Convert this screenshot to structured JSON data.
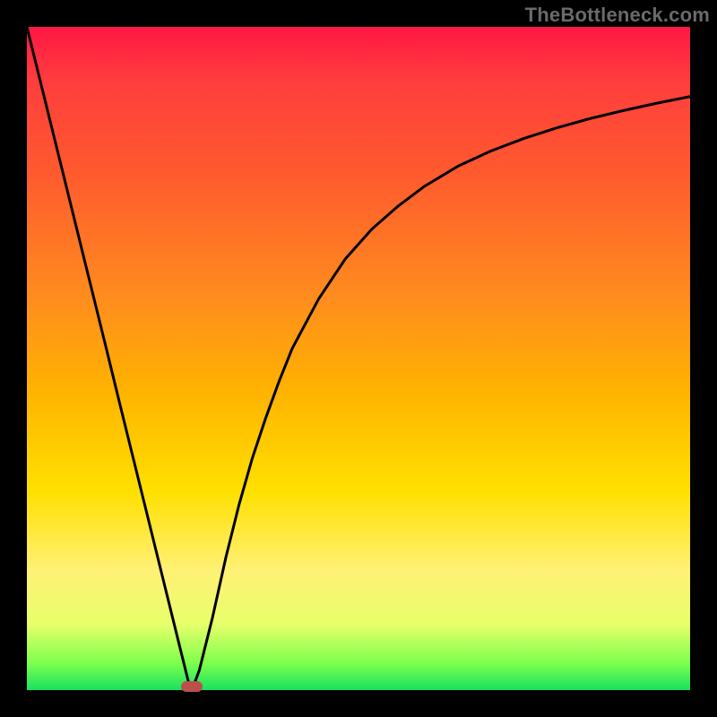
{
  "watermark": "TheBottleneck.com",
  "chart_data": {
    "type": "line",
    "title": "",
    "xlabel": "",
    "ylabel": "",
    "xlim": [
      0,
      100
    ],
    "ylim": [
      0,
      100
    ],
    "x": [
      0,
      2,
      4,
      6,
      8,
      10,
      12,
      14,
      16,
      18,
      20,
      22,
      24,
      24.5,
      25,
      26,
      28,
      30,
      32,
      34,
      36,
      38,
      40,
      44,
      48,
      52,
      56,
      60,
      65,
      70,
      75,
      80,
      85,
      90,
      95,
      100
    ],
    "y": [
      100,
      91.9,
      83.8,
      75.7,
      67.6,
      59.5,
      51.4,
      43.2,
      35.1,
      27,
      18.9,
      10.8,
      2.7,
      0.7,
      0.3,
      3,
      11,
      20,
      28,
      35,
      41,
      46.5,
      51.5,
      59,
      65,
      69.5,
      73,
      76,
      79,
      81.3,
      83.2,
      84.8,
      86.2,
      87.4,
      88.5,
      89.5
    ],
    "marker": {
      "x": 24.8,
      "y": 0.5
    },
    "background_gradient": {
      "stops": [
        {
          "pos": 0,
          "color": "#ff1744"
        },
        {
          "pos": 8,
          "color": "#ff3d3d"
        },
        {
          "pos": 22,
          "color": "#ff5a2e"
        },
        {
          "pos": 40,
          "color": "#ff8a1f"
        },
        {
          "pos": 55,
          "color": "#ffb300"
        },
        {
          "pos": 70,
          "color": "#ffe000"
        },
        {
          "pos": 82,
          "color": "#fff176"
        },
        {
          "pos": 90,
          "color": "#e8ff6a"
        },
        {
          "pos": 96,
          "color": "#7cff4d"
        },
        {
          "pos": 100,
          "color": "#18e060"
        }
      ]
    }
  }
}
